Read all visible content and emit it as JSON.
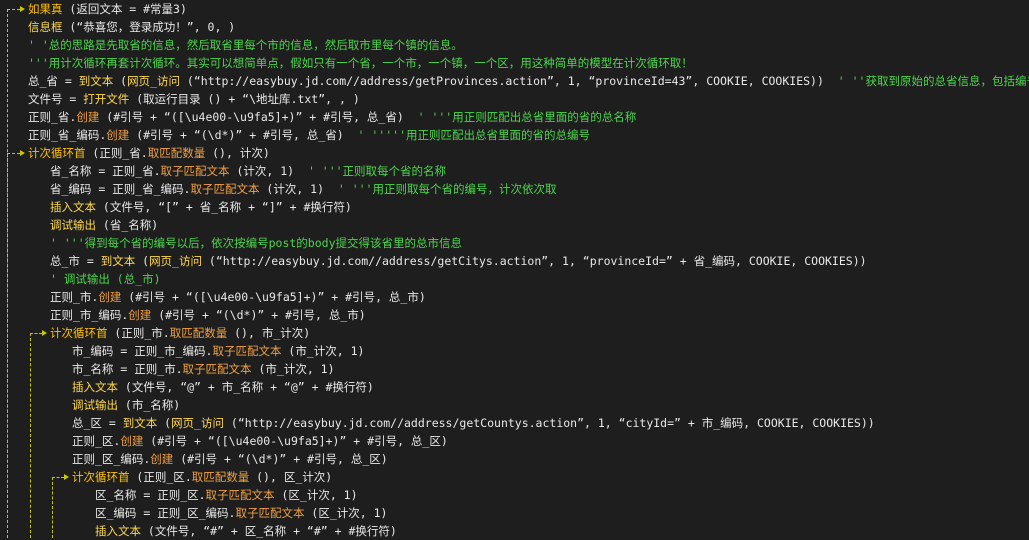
{
  "lines": [
    {
      "indent": 0,
      "kind": "if",
      "tokens": [
        [
          "kw",
          "如果真"
        ],
        [
          "op",
          " (返回文本 = #常量3)"
        ]
      ]
    },
    {
      "indent": 1,
      "tokens": [
        [
          "fn",
          "信息框"
        ],
        [
          "op",
          " (“恭喜您，登录成功！”, 0, )"
        ]
      ]
    },
    {
      "indent": 1,
      "tokens": [
        [
          "cmt",
          "' '总的思路是先取省的信息，然后取省里每个市的信息，然后取市里每个镇的信息。"
        ]
      ]
    },
    {
      "indent": 1,
      "tokens": [
        [
          "cmt",
          "'''用计次循环再套计次循环。其实可以想简单点，假如只有一个省，一个市，一个镇，一个区，用这种简单的模型在计次循环取！"
        ]
      ]
    },
    {
      "indent": 1,
      "tokens": [
        [
          "var",
          "总_省 = "
        ],
        [
          "fn",
          "到文本"
        ],
        [
          "op",
          " ("
        ],
        [
          "fn",
          "网页_访问"
        ],
        [
          "op",
          " (“http://easybuy.jd.com//address/getProvinces.action”, 1, “provinceId=43”, COOKIE, COOKIES))  "
        ],
        [
          "cmt",
          "' ''获取到原始的总省信息，包括编号名称"
        ]
      ]
    },
    {
      "indent": 1,
      "tokens": [
        [
          "var",
          "文件号 = "
        ],
        [
          "fn",
          "打开文件"
        ],
        [
          "op",
          " (取运行目录 () + “\\地址库.txt”, , )"
        ]
      ]
    },
    {
      "indent": 1,
      "tokens": [
        [
          "var",
          "正则_省."
        ],
        [
          "mth",
          "创建"
        ],
        [
          "op",
          " (#引号 + “([\\u4e00-\\u9fa5]+)” + #引号, 总_省)  "
        ],
        [
          "cmt",
          "' '''用正则匹配出总省里面的省的总名称"
        ]
      ]
    },
    {
      "indent": 1,
      "tokens": [
        [
          "var",
          "正则_省_编码."
        ],
        [
          "mth",
          "创建"
        ],
        [
          "op",
          " (#引号 + “(\\d*)” + #引号, 总_省)  "
        ],
        [
          "cmt",
          "' '''''用正则匹配出总省里面的省的总编号"
        ]
      ]
    },
    {
      "indent": 1,
      "kind": "loop",
      "tokens": [
        [
          "kw",
          "计次循环首"
        ],
        [
          "op",
          " (正则_省."
        ],
        [
          "mth",
          "取匹配数量"
        ],
        [
          "op",
          " (), 计次)"
        ]
      ]
    },
    {
      "indent": 2,
      "tokens": [
        [
          "var",
          "省_名称 = 正则_省."
        ],
        [
          "mth",
          "取子匹配文本"
        ],
        [
          "op",
          " (计次, 1)  "
        ],
        [
          "cmt",
          "' '''正则取每个省的名称"
        ]
      ]
    },
    {
      "indent": 2,
      "tokens": [
        [
          "var",
          "省_编码 = 正则_省_编码."
        ],
        [
          "mth",
          "取子匹配文本"
        ],
        [
          "op",
          " (计次, 1)  "
        ],
        [
          "cmt",
          "' '''用正则取每个省的编号，计次依次取"
        ]
      ]
    },
    {
      "indent": 2,
      "tokens": [
        [
          "fn",
          "插入文本"
        ],
        [
          "op",
          " (文件号, “[” + 省_名称 + “]” + #换行符)"
        ]
      ]
    },
    {
      "indent": 2,
      "tokens": [
        [
          "fn",
          "调试输出"
        ],
        [
          "op",
          " (省_名称)"
        ]
      ]
    },
    {
      "indent": 2,
      "tokens": [
        [
          "cmt",
          "' '''得到每个省的编号以后，依次按编号post的body提交得该省里的总市信息"
        ]
      ]
    },
    {
      "indent": 2,
      "tokens": [
        [
          "var",
          "总_市 = "
        ],
        [
          "fn",
          "到文本"
        ],
        [
          "op",
          " ("
        ],
        [
          "fn",
          "网页_访问"
        ],
        [
          "op",
          " (“http://easybuy.jd.com//address/getCitys.action”, 1, “provinceId=” + 省_编码, COOKIE, COOKIES))"
        ]
      ]
    },
    {
      "indent": 2,
      "tokens": [
        [
          "cmt",
          "' 调试输出 (总_市)"
        ]
      ]
    },
    {
      "indent": 2,
      "tokens": [
        [
          "var",
          "正则_市."
        ],
        [
          "mth",
          "创建"
        ],
        [
          "op",
          " (#引号 + “([\\u4e00-\\u9fa5]+)” + #引号, 总_市)"
        ]
      ]
    },
    {
      "indent": 2,
      "tokens": [
        [
          "var",
          "正则_市_编码."
        ],
        [
          "mth",
          "创建"
        ],
        [
          "op",
          " (#引号 + “(\\d*)” + #引号, 总_市)"
        ]
      ]
    },
    {
      "indent": 2,
      "kind": "loop",
      "tokens": [
        [
          "kw",
          "计次循环首"
        ],
        [
          "op",
          " (正则_市."
        ],
        [
          "mth",
          "取匹配数量"
        ],
        [
          "op",
          " (), 市_计次)"
        ]
      ]
    },
    {
      "indent": 3,
      "tokens": [
        [
          "var",
          "市_编码 = 正则_市_编码."
        ],
        [
          "mth",
          "取子匹配文本"
        ],
        [
          "op",
          " (市_计次, 1)"
        ]
      ]
    },
    {
      "indent": 3,
      "tokens": [
        [
          "var",
          "市_名称 = 正则_市."
        ],
        [
          "mth",
          "取子匹配文本"
        ],
        [
          "op",
          " (市_计次, 1)"
        ]
      ]
    },
    {
      "indent": 3,
      "tokens": [
        [
          "fn",
          "插入文本"
        ],
        [
          "op",
          " (文件号, “@” + 市_名称 + “@” + #换行符)"
        ]
      ]
    },
    {
      "indent": 3,
      "tokens": [
        [
          "fn",
          "调试输出"
        ],
        [
          "op",
          " (市_名称)"
        ]
      ]
    },
    {
      "indent": 3,
      "tokens": [
        [
          "var",
          "总_区 = "
        ],
        [
          "fn",
          "到文本"
        ],
        [
          "op",
          " ("
        ],
        [
          "fn",
          "网页_访问"
        ],
        [
          "op",
          " (“http://easybuy.jd.com//address/getCountys.action”, 1, “cityId=” + 市_编码, COOKIE, COOKIES))"
        ]
      ]
    },
    {
      "indent": 3,
      "tokens": [
        [
          "var",
          "正则_区."
        ],
        [
          "mth",
          "创建"
        ],
        [
          "op",
          " (#引号 + “([\\u4e00-\\u9fa5]+)” + #引号, 总_区)"
        ]
      ]
    },
    {
      "indent": 3,
      "tokens": [
        [
          "var",
          "正则_区_编码."
        ],
        [
          "mth",
          "创建"
        ],
        [
          "op",
          " (#引号 + “(\\d*)” + #引号, 总_区)"
        ]
      ]
    },
    {
      "indent": 3,
      "kind": "loop",
      "tokens": [
        [
          "kw",
          "计次循环首"
        ],
        [
          "op",
          " (正则_区."
        ],
        [
          "mth",
          "取匹配数量"
        ],
        [
          "op",
          " (), 区_计次)"
        ]
      ]
    },
    {
      "indent": 4,
      "tokens": [
        [
          "var",
          "区_名称 = 正则_区."
        ],
        [
          "mth",
          "取子匹配文本"
        ],
        [
          "op",
          " (区_计次, 1)"
        ]
      ]
    },
    {
      "indent": 4,
      "tokens": [
        [
          "var",
          "区_编码 = 正则_区_编码."
        ],
        [
          "mth",
          "取子匹配文本"
        ],
        [
          "op",
          " (区_计次, 1)"
        ]
      ]
    },
    {
      "indent": 4,
      "tokens": [
        [
          "fn",
          "插入文本"
        ],
        [
          "op",
          " (文件号, “#” + 区_名称 + “#” + #换行符)"
        ]
      ]
    }
  ]
}
